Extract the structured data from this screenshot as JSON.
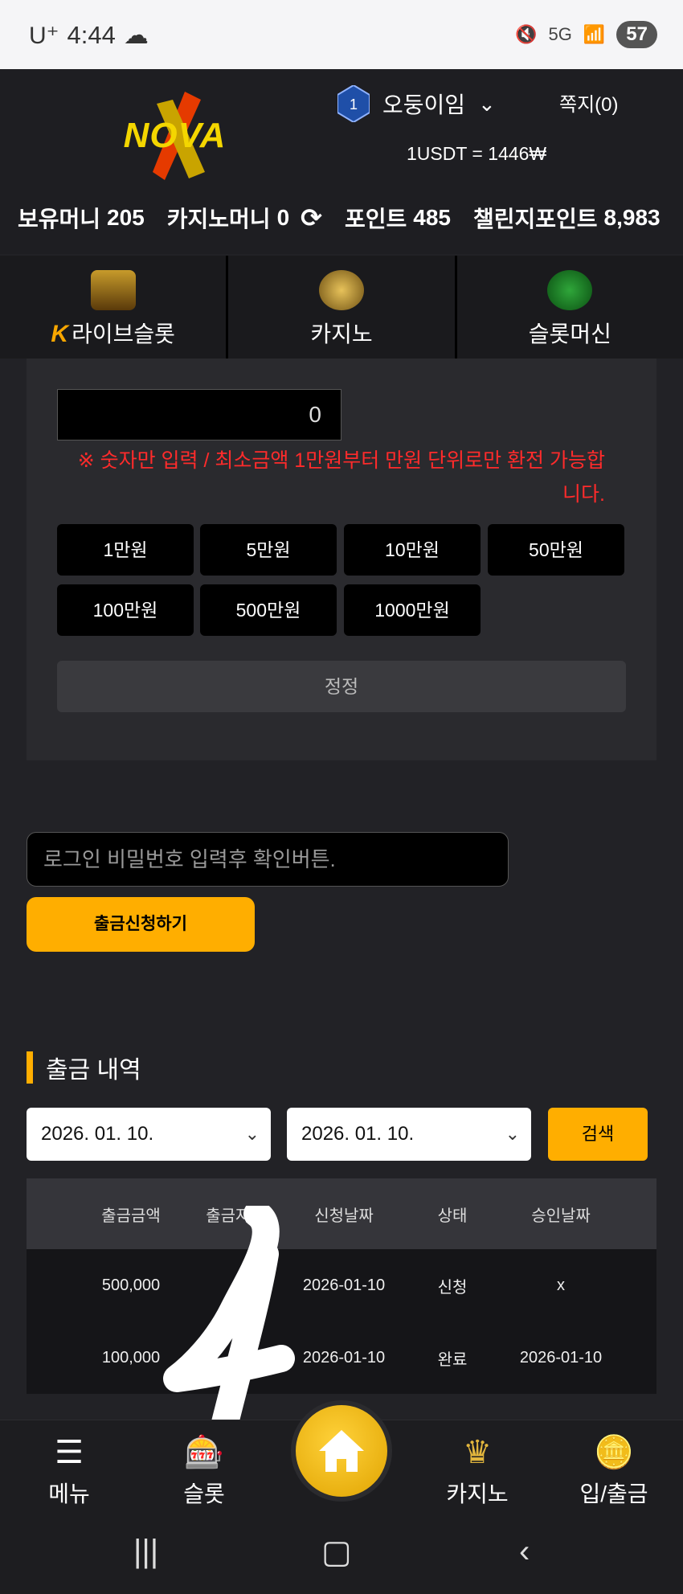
{
  "status_bar": {
    "carrier": "U⁺",
    "time": "4:44",
    "battery": "57",
    "network": "5G"
  },
  "header": {
    "logo_text": "NOVA",
    "level": "1",
    "username": "오둥이임",
    "notes": "쪽지(0)",
    "rate": "1USDT = 1446₩",
    "balances": {
      "holding_label": "보유머니",
      "holding_value": "205",
      "casino_label": "카지노머니",
      "casino_value": "0",
      "point_label": "포인트",
      "point_value": "485",
      "challenge_label": "챌린지포인트",
      "challenge_value": "8,983"
    }
  },
  "categories": [
    {
      "label": "라이브슬롯",
      "icon": "live-slot-icon"
    },
    {
      "label": "카지노",
      "icon": "k-slot-icon"
    },
    {
      "label": "슬롯머신",
      "icon": "slot-777-icon"
    }
  ],
  "exchange": {
    "amount_value": "0",
    "warning": "※ 숫자만 입력 / 최소금액 1만원부터 만원 단위로만 환전 가능합니다.",
    "amount_buttons": [
      "1만원",
      "5만원",
      "10만원",
      "50만원",
      "100만원",
      "500만원",
      "1000만원"
    ],
    "confirm_label": "정정"
  },
  "withdraw": {
    "password_placeholder": "로그인 비밀번호 입력후 확인버튼.",
    "submit_label": "출금신청하기"
  },
  "history": {
    "title": "출금 내역",
    "date_from": "2026. 01. 10.",
    "date_to": "2026. 01. 10.",
    "search_label": "검색",
    "columns": [
      "출금금액",
      "출금자명",
      "신청날짜",
      "상태",
      "승인날짜"
    ],
    "rows": [
      {
        "amount": "500,000",
        "name": "",
        "date": "2026-01-10",
        "status": "신청",
        "approved": "x"
      },
      {
        "amount": "100,000",
        "name": "",
        "date": "2026-01-10",
        "status": "완료",
        "approved": "2026-01-10"
      }
    ]
  },
  "bottom_nav": [
    {
      "label": "메뉴",
      "icon": "hamburger-icon"
    },
    {
      "label": "슬롯",
      "icon": "slot-icon"
    },
    {
      "label": "",
      "icon": "home-icon"
    },
    {
      "label": "카지노",
      "icon": "k-slot-icon"
    },
    {
      "label": "입/출금",
      "icon": "coins-icon"
    }
  ],
  "colors": {
    "accent": "#ffae00",
    "warning": "#ff2b2b",
    "background": "#222226"
  }
}
